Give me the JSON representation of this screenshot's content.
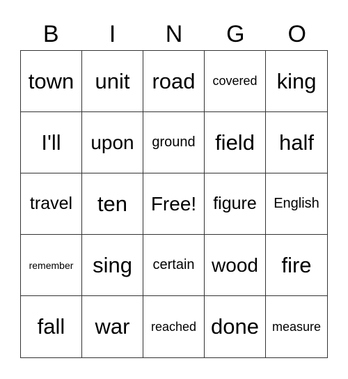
{
  "header": [
    "B",
    "I",
    "N",
    "G",
    "O"
  ],
  "cells": [
    "town",
    "unit",
    "road",
    "covered",
    "king",
    "I'll",
    "upon",
    "ground",
    "field",
    "half",
    "travel",
    "ten",
    "Free!",
    "figure",
    "English",
    "remember",
    "sing",
    "certain",
    "wood",
    "fire",
    "fall",
    "war",
    "reached",
    "done",
    "measure"
  ]
}
